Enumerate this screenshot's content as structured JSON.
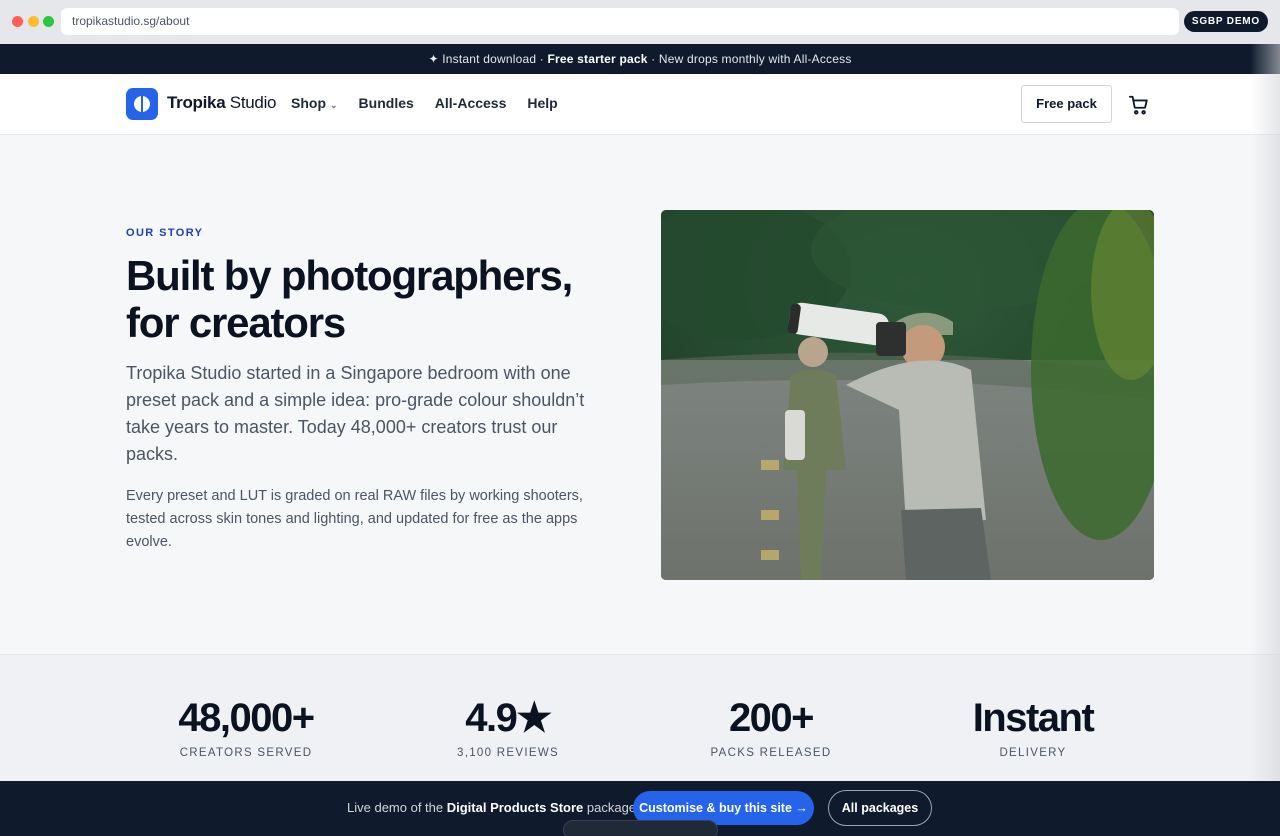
{
  "browser": {
    "url": "tropikastudio.sg/about",
    "badge": "SGBP DEMO"
  },
  "announcement": {
    "prefix": "✦ Instant download · ",
    "bold": "Free starter pack",
    "suffix": " · New drops monthly with All-Access"
  },
  "header": {
    "brand_bold": "Tropika",
    "brand_rest": " Studio",
    "nav": [
      "Shop",
      "Bundles",
      "All-Access",
      "Help"
    ],
    "free_pack": "Free pack",
    "icons": [
      "logo-mark",
      "chevron-down-icon",
      "cart-icon"
    ]
  },
  "hero": {
    "eyebrow": "OUR STORY",
    "title": "Built by photographers, for creators",
    "lead": "Tropika Studio started in a Singapore bedroom with one preset pack and a simple idea: pro-grade colour shouldn’t take years to master. Today 48,000+ creators trust our packs.",
    "body": "Every preset and LUT is graded on real RAW files by working shooters, tested across skin tones and lighting, and updated for free as the apps evolve."
  },
  "stats": [
    {
      "value": "48,000+",
      "label": "CREATORS SERVED"
    },
    {
      "value": "4.9★",
      "label": "3,100 REVIEWS"
    },
    {
      "value": "200+",
      "label": "PACKS RELEASED"
    },
    {
      "value": "Instant",
      "label": "DELIVERY"
    }
  ],
  "bottom_bar": {
    "prefix": "Live demo of the ",
    "bold": "Digital Products Store",
    "suffix": " package.",
    "cta": "Customise & buy this site →",
    "all_packages": "All packages"
  },
  "colors": {
    "accent": "#2563eb",
    "dark": "#0f1b2d",
    "eyebrow": "#1e40af"
  }
}
